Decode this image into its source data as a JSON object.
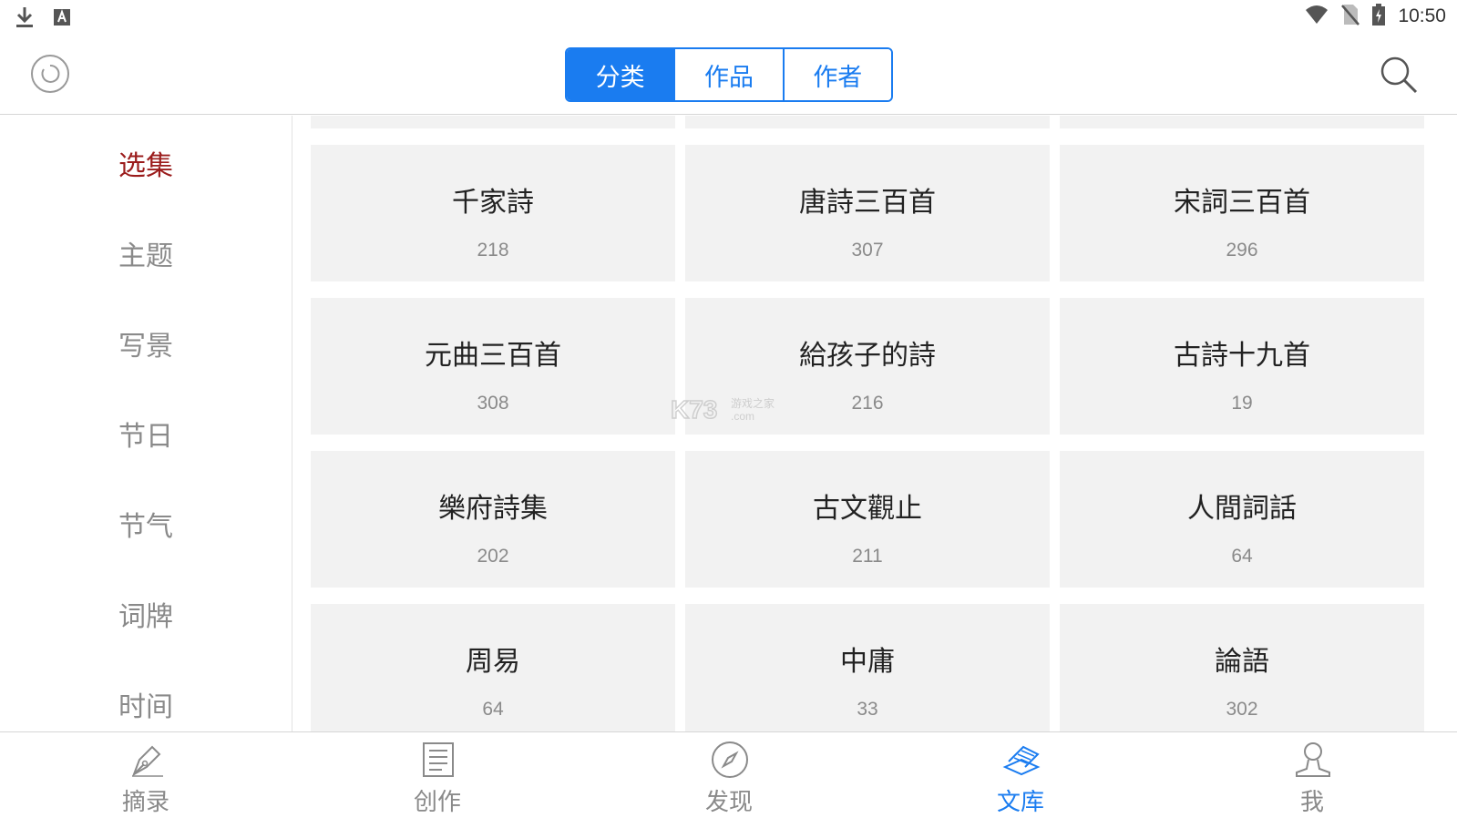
{
  "status_bar": {
    "time": "10:50",
    "left_icons": [
      "download-icon",
      "font-a-icon"
    ],
    "right_icons": [
      "wifi-icon",
      "no-sim-icon",
      "battery-charging-icon"
    ]
  },
  "header": {
    "refresh_icon": "refresh-circle-icon",
    "search_icon": "search-icon",
    "segments": [
      {
        "label": "分类",
        "active": true
      },
      {
        "label": "作品",
        "active": false
      },
      {
        "label": "作者",
        "active": false
      }
    ]
  },
  "sidebar": {
    "items": [
      {
        "label": "选集",
        "active": true
      },
      {
        "label": "主题",
        "active": false
      },
      {
        "label": "写景",
        "active": false
      },
      {
        "label": "节日",
        "active": false
      },
      {
        "label": "节气",
        "active": false
      },
      {
        "label": "词牌",
        "active": false
      },
      {
        "label": "时间",
        "active": false
      }
    ]
  },
  "collections": [
    {
      "title": "千家詩",
      "count": "218"
    },
    {
      "title": "唐詩三百首",
      "count": "307"
    },
    {
      "title": "宋詞三百首",
      "count": "296"
    },
    {
      "title": "元曲三百首",
      "count": "308"
    },
    {
      "title": "給孩子的詩",
      "count": "216"
    },
    {
      "title": "古詩十九首",
      "count": "19"
    },
    {
      "title": "樂府詩集",
      "count": "202"
    },
    {
      "title": "古文觀止",
      "count": "211"
    },
    {
      "title": "人間詞話",
      "count": "64"
    },
    {
      "title": "周易",
      "count": "64"
    },
    {
      "title": "中庸",
      "count": "33"
    },
    {
      "title": "論語",
      "count": "302"
    }
  ],
  "tabbar": {
    "tabs": [
      {
        "label": "摘录",
        "icon": "pen-nib-icon",
        "active": false
      },
      {
        "label": "创作",
        "icon": "document-icon",
        "active": false
      },
      {
        "label": "发现",
        "icon": "compass-icon",
        "active": false
      },
      {
        "label": "文库",
        "icon": "books-icon",
        "active": true
      },
      {
        "label": "我",
        "icon": "user-icon",
        "active": false
      }
    ]
  },
  "watermark": {
    "text": "K73",
    "subtext": "游戏之家",
    "domain": ".com"
  },
  "colors": {
    "accent": "#1a7cf0",
    "sidebar_active": "#9b1c1c",
    "card_bg": "#f2f2f2",
    "muted": "#8a8a8a"
  }
}
